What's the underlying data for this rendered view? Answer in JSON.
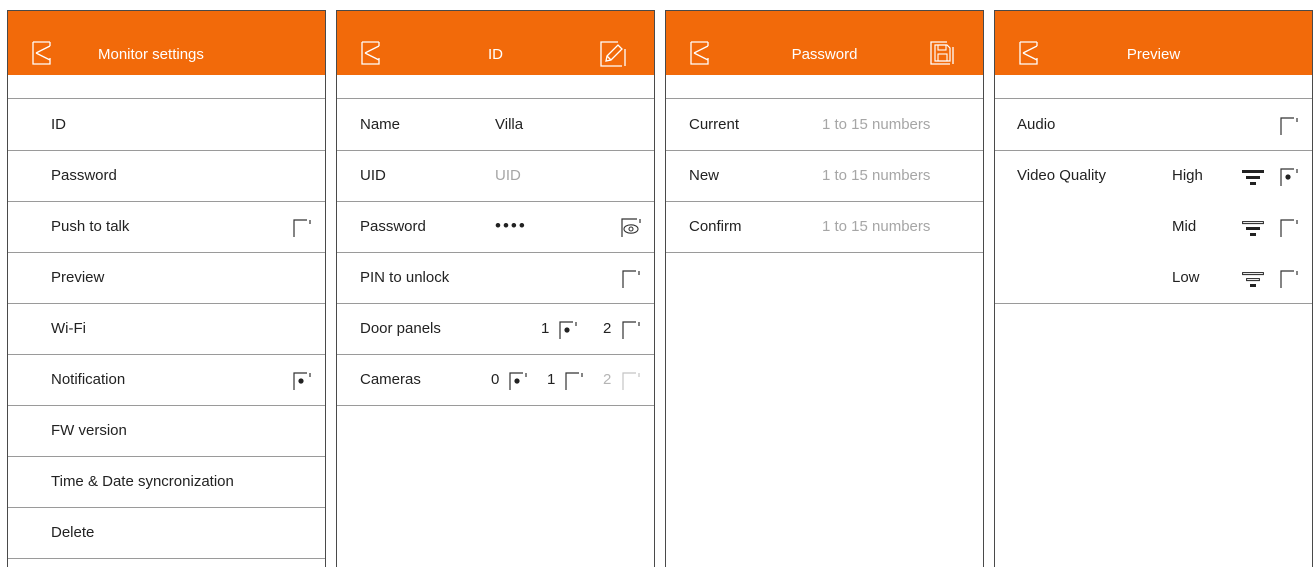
{
  "colors": {
    "accent": "#f26a0a",
    "divider": "#9a9a9a",
    "placeholder": "#a6a6a6"
  },
  "monitor_settings": {
    "title": "Monitor settings",
    "back_icon": "back-icon",
    "items": [
      {
        "label": "ID"
      },
      {
        "label": "Password"
      },
      {
        "label": "Push to talk",
        "checkbox": "unchecked"
      },
      {
        "label": "Preview"
      },
      {
        "label": "Wi-Fi"
      },
      {
        "label": "Notification",
        "checkbox": "checked"
      },
      {
        "label": "FW version"
      },
      {
        "label": "Time & Date syncronization"
      },
      {
        "label": "Delete"
      }
    ]
  },
  "id_screen": {
    "title": "ID",
    "back_icon": "back-icon",
    "edit_icon": "edit-pencil-icon",
    "name": {
      "label": "Name",
      "value": "Villa"
    },
    "uid": {
      "label": "UID",
      "placeholder": "UID"
    },
    "password": {
      "label": "Password",
      "value": "••••",
      "icon": "show-password-eye-icon"
    },
    "pin_to_unlock": {
      "label": "PIN to unlock",
      "checkbox": "unchecked"
    },
    "door_panels": {
      "label": "Door panels",
      "options": [
        {
          "num": "1",
          "state": "checked"
        },
        {
          "num": "2",
          "state": "unchecked"
        }
      ]
    },
    "cameras": {
      "label": "Cameras",
      "options": [
        {
          "num": "0",
          "state": "checked"
        },
        {
          "num": "1",
          "state": "unchecked"
        },
        {
          "num": "2",
          "state": "disabled"
        }
      ]
    }
  },
  "password_screen": {
    "title": "Password",
    "back_icon": "back-icon",
    "save_icon": "save-floppy-icon",
    "fields": [
      {
        "label": "Current",
        "placeholder": "1 to 15 numbers"
      },
      {
        "label": "New",
        "placeholder": "1 to 15 numbers"
      },
      {
        "label": "Confirm",
        "placeholder": "1 to 15 numbers"
      }
    ]
  },
  "preview_screen": {
    "title": "Preview",
    "back_icon": "back-icon",
    "audio": {
      "label": "Audio",
      "checkbox": "unchecked"
    },
    "video_quality": {
      "label": "Video Quality",
      "options": [
        {
          "label": "High",
          "icon": "quality-high-icon",
          "checkbox": "checked"
        },
        {
          "label": "Mid",
          "icon": "quality-mid-icon",
          "checkbox": "unchecked"
        },
        {
          "label": "Low",
          "icon": "quality-low-icon",
          "checkbox": "unchecked"
        }
      ]
    }
  }
}
